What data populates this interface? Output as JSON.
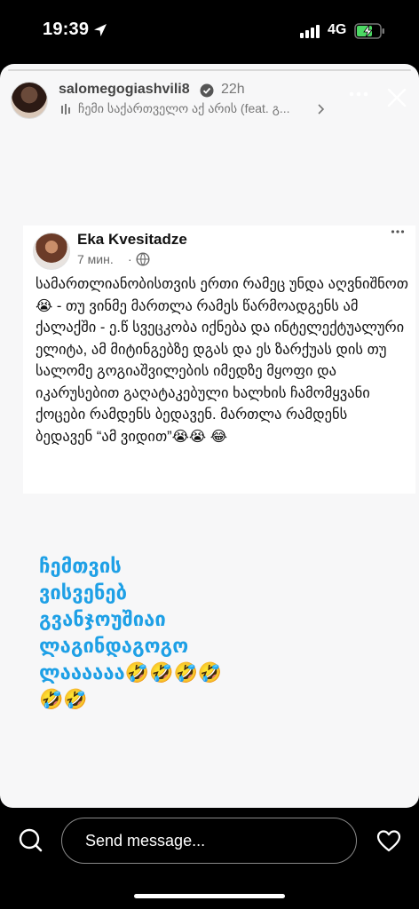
{
  "status_bar": {
    "time": "19:39",
    "network": "4G",
    "icons": [
      "location-arrow-icon",
      "signal-bars-icon",
      "battery-charging-icon"
    ],
    "battery_color": "#4cd964"
  },
  "story": {
    "progress": 0.0,
    "username": "salomegogiashvili8",
    "age": "22h",
    "music": "ჩემი საქართველო აქ არის (feat. გ...",
    "text": "ჩემთვის\nვისვენებ\nგვანჯოუშიაი\nლაგინდაგოგო\nლაააააა🤣🤣🤣🤣\n🤣🤣",
    "text_color": "#1ea0e6"
  },
  "post": {
    "author": "Eka Kvesitadze",
    "time": "7 мин.",
    "dot": "·",
    "body": "სამართლიანობისთვის ერთი რამეც უნდა აღვნიშნოთ  😭 - თუ ვინმე მართლა რამეს წარმოადგენს ამ ქალაქში - ე.წ სვეცკობა იქნება და ინტელექტუალური  ელიტა, ამ მიტინგებზე დგას და ეს  ზარქუას დის თუ სალომე გოგიაშვილების იმედზე მყოფი და იკარუსებით გაღატაკებული ხალხის ჩამომყვანი ქოცები რამდენს ბედავენ. მართლა რამდენს ბედავენ “ამ ვიდით”😭😭 😂"
  },
  "footer": {
    "placeholder": "Send message...",
    "icons": [
      "camera-icon",
      "heart-icon"
    ]
  }
}
